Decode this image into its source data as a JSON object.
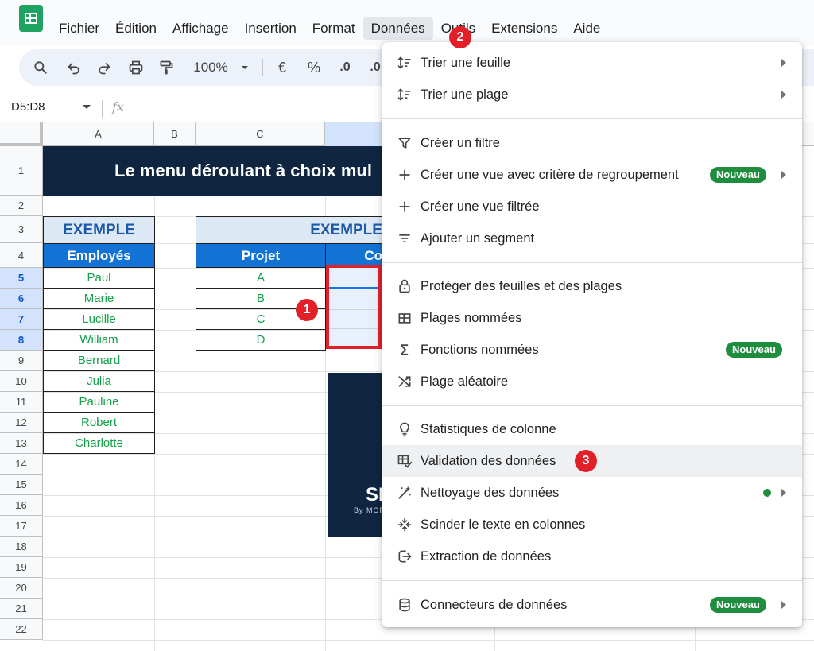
{
  "menubar": {
    "items": [
      "Fichier",
      "Édition",
      "Affichage",
      "Insertion",
      "Format",
      "Données",
      "Outils",
      "Extensions",
      "Aide"
    ],
    "active_index": 5
  },
  "toolbar": {
    "zoom": "100%",
    "currency": "€",
    "percent": "%",
    "decimal": ".0"
  },
  "formula_bar": {
    "name_box": "D5:D8",
    "fx": "fx"
  },
  "sheet": {
    "columns": [
      "A",
      "B",
      "C"
    ],
    "rows": [
      "1",
      "2",
      "3",
      "4",
      "5",
      "6",
      "7",
      "8",
      "9",
      "10",
      "11",
      "12",
      "13",
      "14",
      "15",
      "16",
      "17",
      "18",
      "19",
      "20",
      "21",
      "22"
    ],
    "selected_rows": [
      5,
      6,
      7,
      8
    ],
    "title": "Le menu déroulant à choix mul",
    "left_table": {
      "title": "EXEMPLE",
      "header": "Employés",
      "values": [
        "Paul",
        "Marie",
        "Lucille",
        "William",
        "Bernard",
        "Julia",
        "Pauline",
        "Robert",
        "Charlotte"
      ]
    },
    "right_table": {
      "title": "EXEMPLE",
      "header_projet": "Projet",
      "header_partial": "Co",
      "values": [
        "A",
        "B",
        "C",
        "D"
      ]
    },
    "card": {
      "big": "SI",
      "small": "By MOR"
    }
  },
  "dropdown": {
    "items": [
      {
        "label": "Trier une feuille",
        "icon": "sort-icon",
        "submenu": true
      },
      {
        "label": "Trier une plage",
        "icon": "sort-icon",
        "submenu": true
      },
      {
        "label": "Créer un filtre",
        "icon": "filter-icon"
      },
      {
        "label": "Créer une vue avec critère de regroupement",
        "icon": "plus-icon",
        "badge": "Nouveau",
        "submenu": true
      },
      {
        "label": "Créer une vue filtrée",
        "icon": "plus-icon"
      },
      {
        "label": "Ajouter un segment",
        "icon": "slicer-icon"
      },
      {
        "label": "Protéger des feuilles et des plages",
        "icon": "lock-icon"
      },
      {
        "label": "Plages nommées",
        "icon": "named-range-icon"
      },
      {
        "label": "Fonctions nommées",
        "icon": "sigma-icon",
        "badge": "Nouveau"
      },
      {
        "label": "Plage aléatoire",
        "icon": "shuffle-icon"
      },
      {
        "label": "Statistiques de colonne",
        "icon": "lightbulb-icon"
      },
      {
        "label": "Validation des données",
        "icon": "data-validation-icon"
      },
      {
        "label": "Nettoyage des données",
        "icon": "magic-wand-icon",
        "dot": true,
        "submenu": true
      },
      {
        "label": "Scinder le texte en colonnes",
        "icon": "split-icon"
      },
      {
        "label": "Extraction de données",
        "icon": "extract-icon"
      },
      {
        "label": "Connecteurs de données",
        "icon": "database-icon",
        "badge": "Nouveau",
        "submenu": true
      }
    ]
  },
  "markers": [
    "1",
    "2",
    "3"
  ],
  "colors": {
    "accent_green": "#1e8e3e",
    "banner_navy": "#0f2540",
    "header_blue": "#1273d4",
    "marker_red": "#e2202a"
  }
}
